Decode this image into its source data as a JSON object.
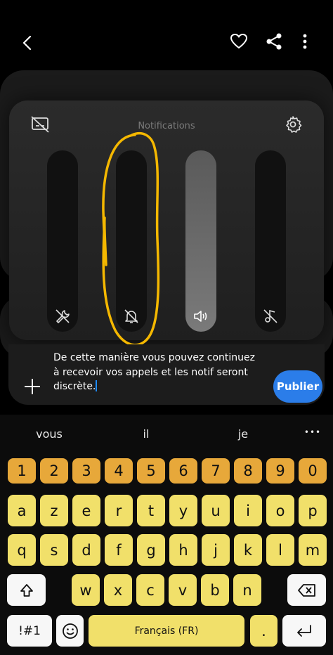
{
  "panel": {
    "title": "Notifications"
  },
  "sliders": [
    {
      "icon": "wrench-mute-icon",
      "active": false
    },
    {
      "icon": "bell-off-icon",
      "active": false
    },
    {
      "icon": "speaker-icon",
      "active": true
    },
    {
      "icon": "music-off-icon",
      "active": false
    }
  ],
  "comment": {
    "text": "De cette manière vous pouvez continuez à recevoir vos appels et les notif seront discrète.",
    "publish_label": "Publier"
  },
  "keyboard": {
    "suggestions": [
      "vous",
      "il",
      "je"
    ],
    "more": "•••",
    "row_numbers": [
      "1",
      "2",
      "3",
      "4",
      "5",
      "6",
      "7",
      "8",
      "9",
      "0"
    ],
    "row1": [
      "a",
      "z",
      "e",
      "r",
      "t",
      "y",
      "u",
      "i",
      "o",
      "p"
    ],
    "row2": [
      "q",
      "s",
      "d",
      "f",
      "g",
      "h",
      "j",
      "k",
      "l",
      "m"
    ],
    "row3": [
      "w",
      "x",
      "c",
      "v",
      "b",
      "n"
    ],
    "symbols_label": "!#1",
    "space_label": "Français (FR)",
    "period_label": "."
  },
  "colors": {
    "accent": "#2b7de9",
    "number_key": "#e7a83a",
    "letter_key": "#f1e06a",
    "annotation": "#f5b800"
  }
}
